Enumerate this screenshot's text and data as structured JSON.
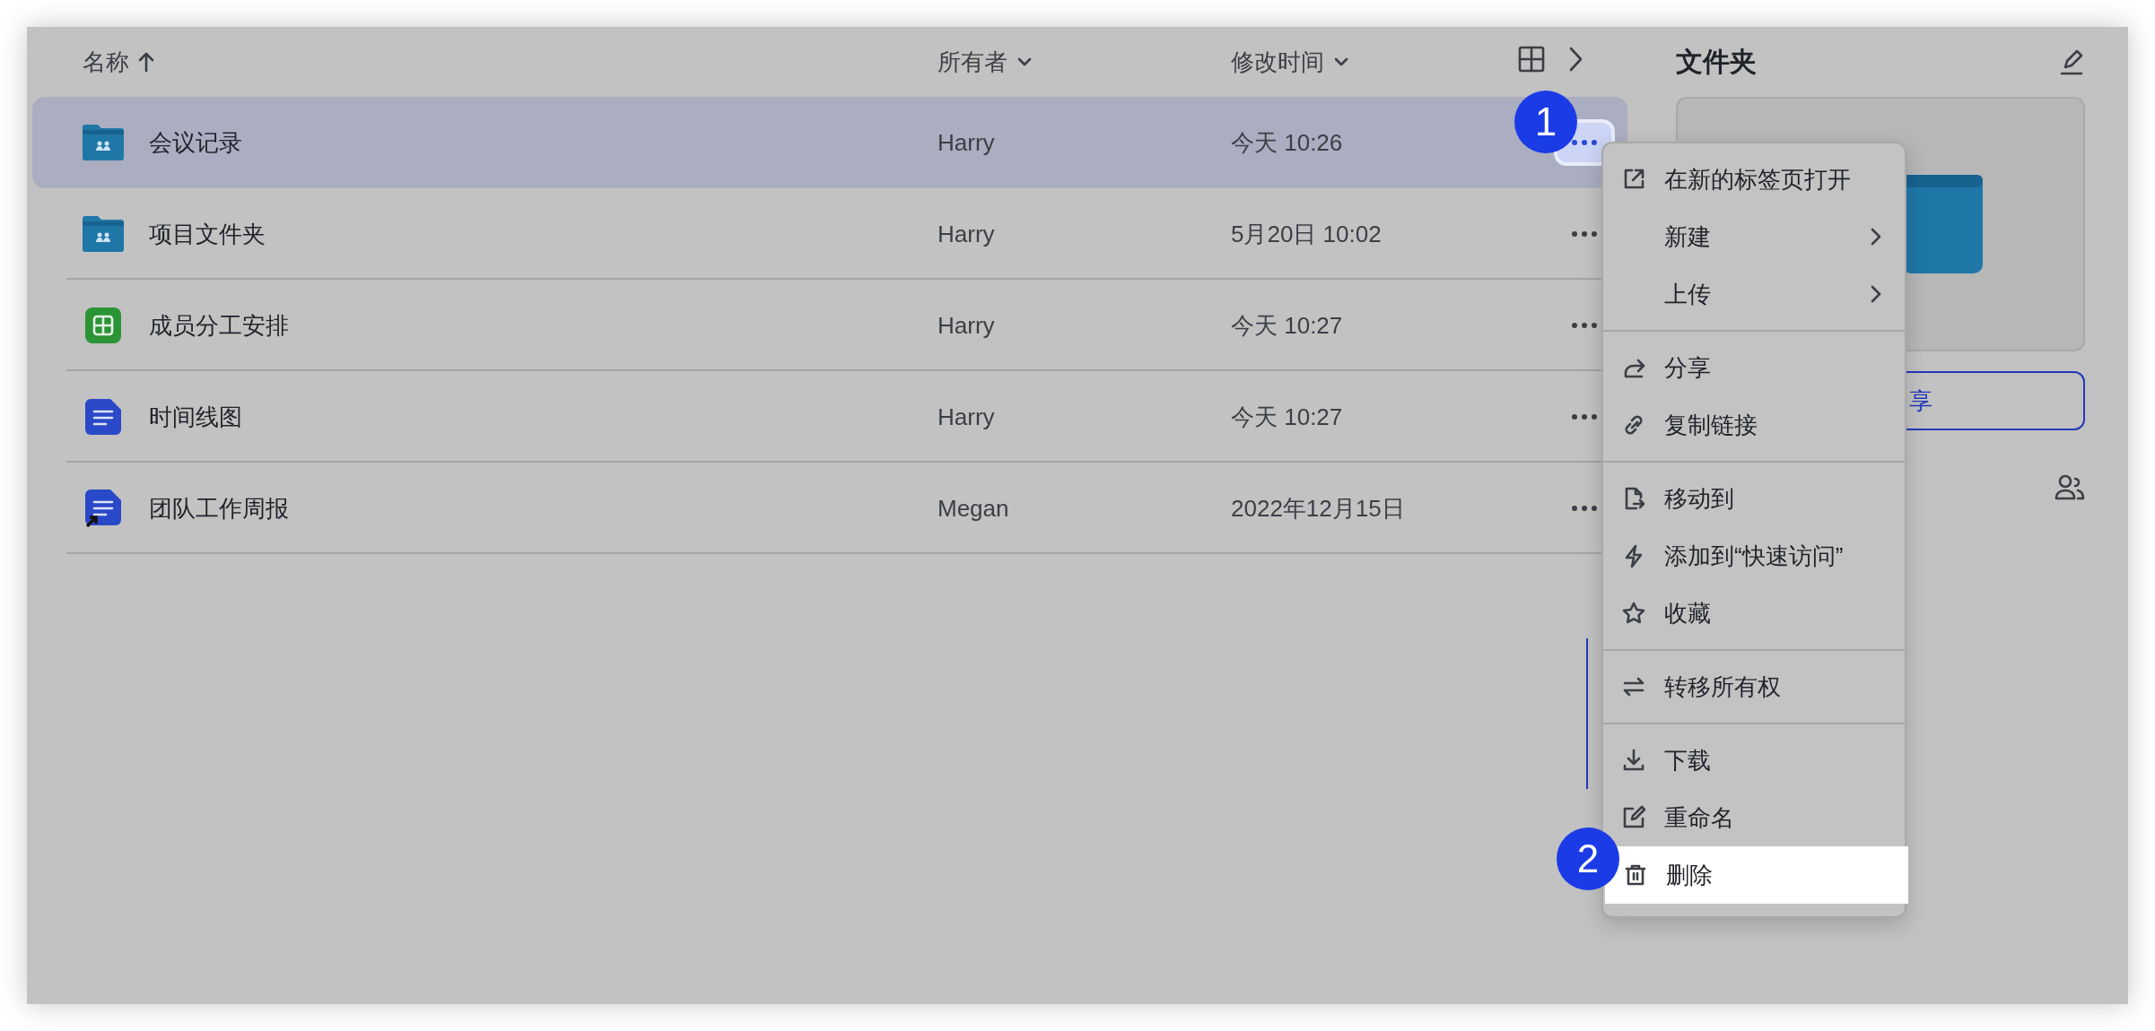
{
  "columns": [
    {
      "label": "名称",
      "kind": "sort-up"
    },
    {
      "label": "所有者",
      "kind": "dropdown"
    },
    {
      "label": "修改时间",
      "kind": "dropdown"
    }
  ],
  "rows": [
    {
      "name": "会议记录",
      "kind": "shared-folder",
      "owner": "Harry",
      "modified": "今天 10:26",
      "selected": true
    },
    {
      "name": "项目文件夹",
      "kind": "shared-folder",
      "owner": "Harry",
      "modified": "5月20日 10:02",
      "selected": false
    },
    {
      "name": "成员分工安排",
      "kind": "sheet",
      "owner": "Harry",
      "modified": "今天 10:27",
      "selected": false
    },
    {
      "name": "时间线图",
      "kind": "doc",
      "owner": "Harry",
      "modified": "今天 10:27",
      "selected": false
    },
    {
      "name": "团队工作周报",
      "kind": "doc-shortcut",
      "owner": "Megan",
      "modified": "2022年12月15日",
      "selected": false
    }
  ],
  "panel": {
    "title": "文件夹",
    "share_button": "享"
  },
  "menu": {
    "groups": [
      [
        {
          "label": "在新的标签页打开",
          "kind": "open",
          "submenu": false,
          "selected": false
        },
        {
          "label": "新建",
          "kind": "plain",
          "submenu": true,
          "selected": false
        },
        {
          "label": "上传",
          "kind": "plain",
          "submenu": true,
          "selected": false
        }
      ],
      [
        {
          "label": "分享",
          "kind": "share",
          "submenu": false,
          "selected": false
        },
        {
          "label": "复制链接",
          "kind": "link",
          "submenu": false,
          "selected": false
        }
      ],
      [
        {
          "label": "移动到",
          "kind": "move",
          "submenu": false,
          "selected": false
        },
        {
          "label": "添加到“快速访问”",
          "kind": "quick",
          "submenu": false,
          "selected": false
        },
        {
          "label": "收藏",
          "kind": "favorite",
          "submenu": false,
          "selected": false
        }
      ],
      [
        {
          "label": "转移所有权",
          "kind": "transfer",
          "submenu": false,
          "selected": false
        }
      ],
      [
        {
          "label": "下载",
          "kind": "download",
          "submenu": false,
          "selected": false
        },
        {
          "label": "重命名",
          "kind": "rename",
          "submenu": false,
          "selected": false
        },
        {
          "label": "删除",
          "kind": "delete",
          "submenu": false,
          "selected": true
        }
      ]
    ]
  },
  "callouts": [
    {
      "number": "1"
    },
    {
      "number": "2"
    }
  ]
}
